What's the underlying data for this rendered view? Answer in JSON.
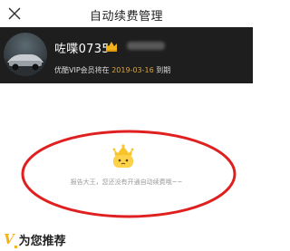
{
  "navbar": {
    "title": "自动续费管理",
    "back_icon": "close-x-icon"
  },
  "member": {
    "nickname": "咗喋0735",
    "vip_badge_icon": "crown-icon",
    "expiry_prefix": "优酷VIP会员将在",
    "expiry_date": "2019-03-16",
    "expiry_suffix": "到期"
  },
  "empty_state": {
    "icon": "crown-mascot-icon",
    "message": "报告大王，您还没有开通自动续费哦~~",
    "highlight_color": "#e02020"
  },
  "recommend": {
    "mark": "V",
    "title": "为您推荐"
  },
  "colors": {
    "accent": "#f3b31a",
    "date": "#d9a441",
    "member_bg": "#1e1e1e"
  }
}
